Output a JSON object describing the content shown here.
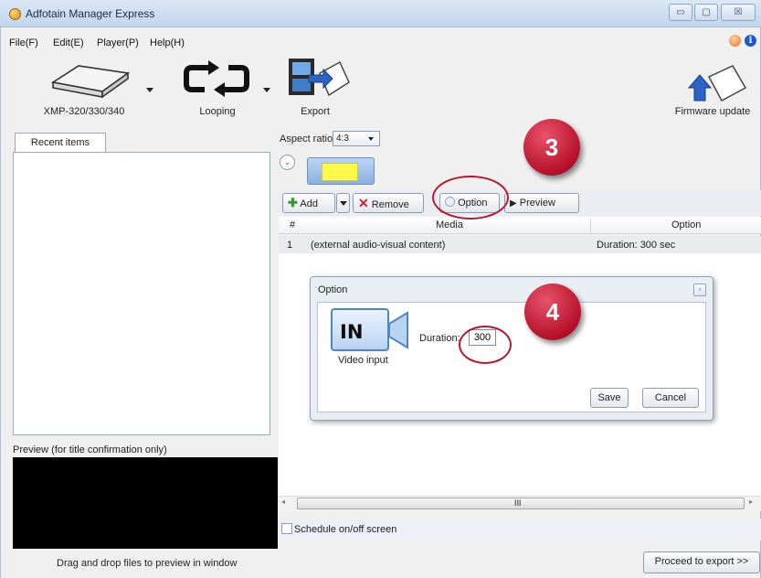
{
  "window": {
    "title": "Adfotain Manager Express",
    "controls": {
      "minimize": "▭",
      "maximize": "▢",
      "close": "☒"
    }
  },
  "menu": [
    "File(F)",
    "Edit(E)",
    "Player(P)",
    "Help(H)"
  ],
  "help_icons": {
    "info": "i"
  },
  "toolbar": {
    "player_label": "XMP-320/330/340",
    "looping_label": "Looping",
    "export_label": "Export",
    "firmware_label": "Firmware update"
  },
  "left_panel": {
    "recent_tab": "Recent items",
    "preview_label": "Preview (for title confirmation only)",
    "drag_label": "Drag and drop files to preview in window"
  },
  "right_panel": {
    "aspect_label": "Aspect ratio",
    "aspect_value": "4:3",
    "collapse_glyph": "⌄",
    "buttons": {
      "add": "Add",
      "remove": "Remove",
      "option": "Option",
      "preview": "Preview"
    },
    "table": {
      "columns": [
        "#",
        "Media",
        "Option"
      ],
      "rows": [
        {
          "index": "1",
          "media": "(external audio-visual content)",
          "option": "Duration: 300 sec"
        }
      ]
    },
    "scroll_grip": "III",
    "schedule_label": "Schedule on/off screen",
    "proceed_label": "Proceed to export >>"
  },
  "dialog": {
    "title": "Option",
    "close_glyph": "▫",
    "icon_text": "IN",
    "icon_caption": "Video input",
    "duration_label": "Duration:",
    "duration_value": "300",
    "save": "Save",
    "cancel": "Cancel"
  },
  "annotations": {
    "step3": "3",
    "step4": "4"
  },
  "colors": {
    "annotation_red": "#b8182d",
    "preview_black": "#000000",
    "thumb_yellow": "#fff94a"
  }
}
